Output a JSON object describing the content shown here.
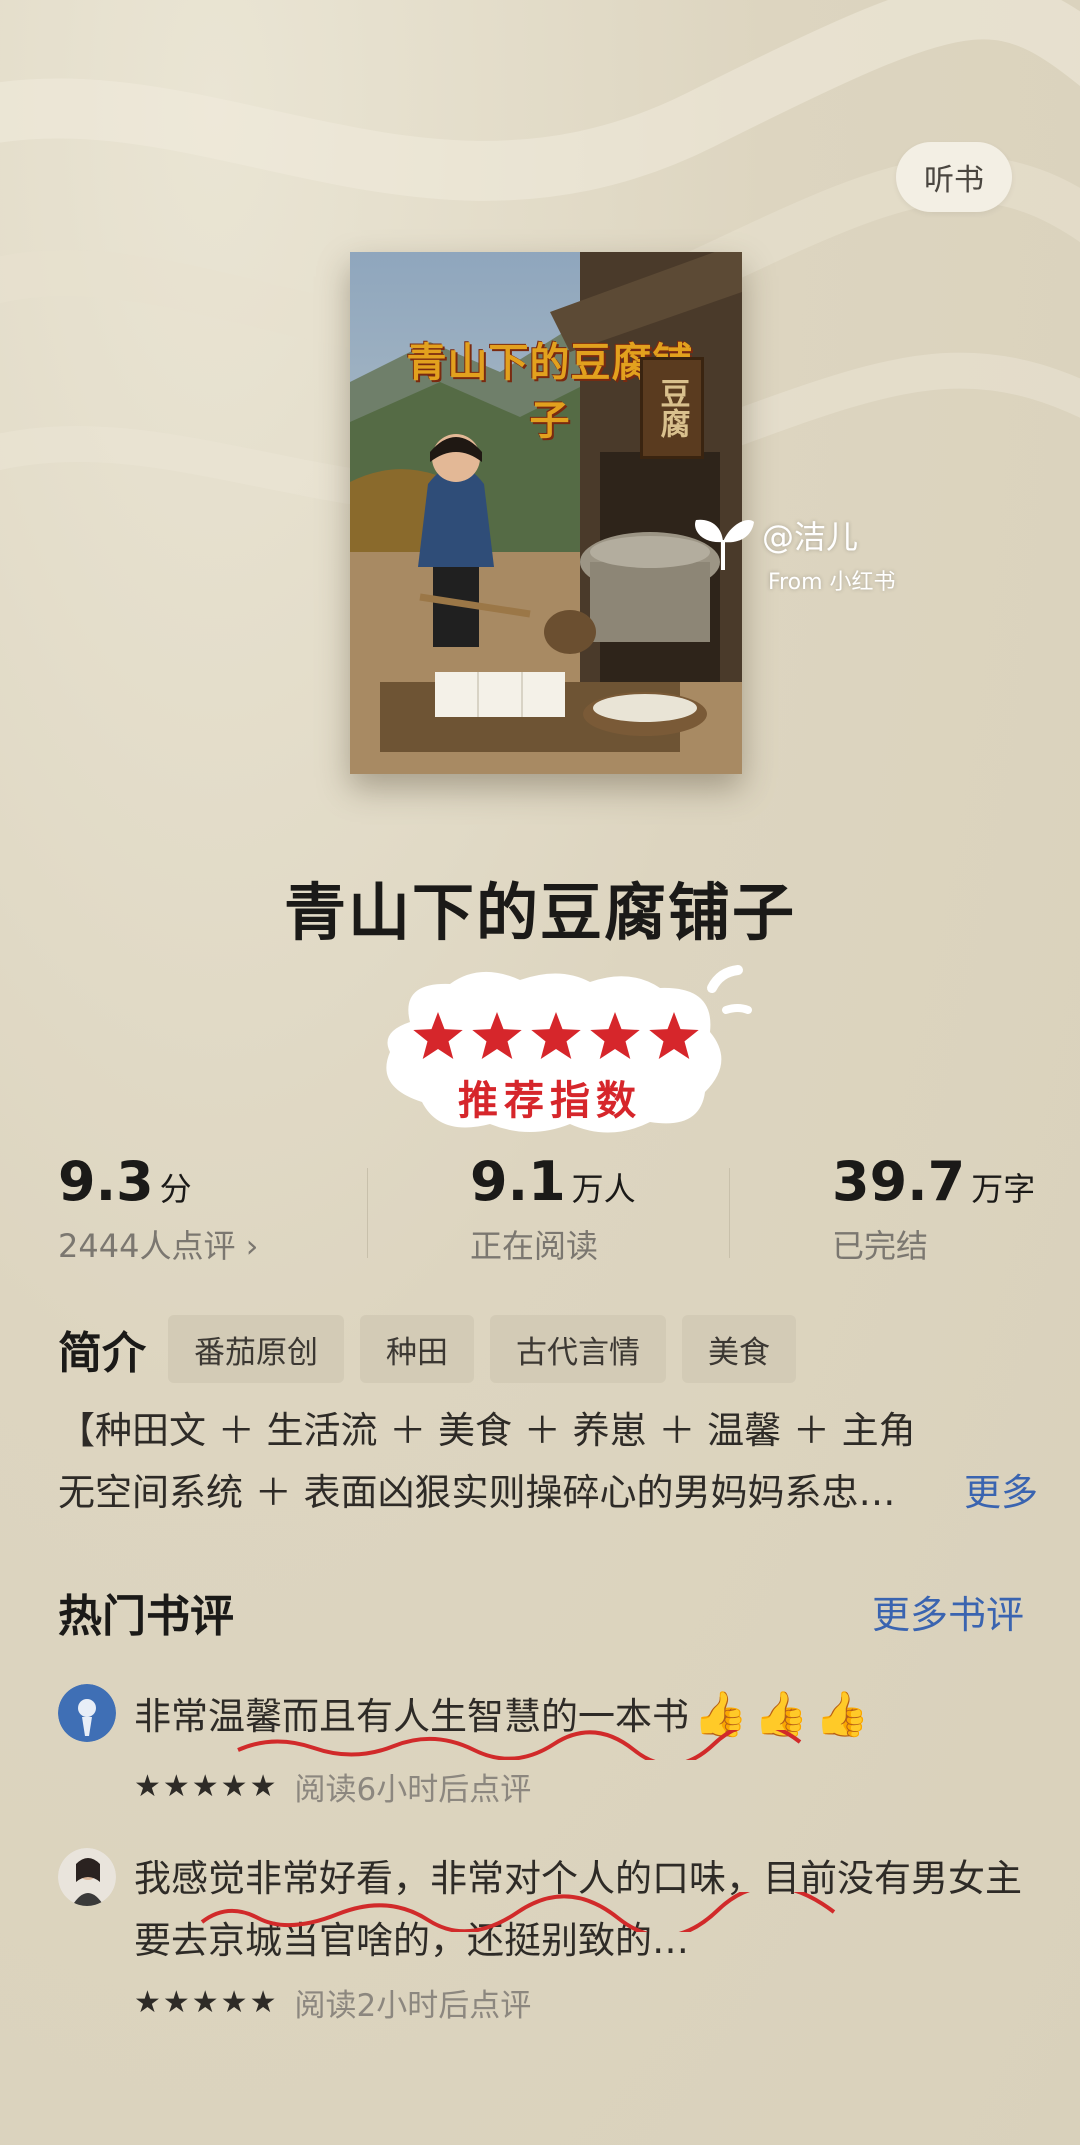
{
  "header": {
    "listen_label": "听书"
  },
  "cover": {
    "title": "青山下的豆腐铺子",
    "sign_text": "豆腐"
  },
  "watermark": {
    "user": "@洁儿",
    "from": "From 小红书"
  },
  "book": {
    "title": "青山下的豆腐铺子"
  },
  "badge": {
    "stars_count": 5,
    "text": "推荐指数",
    "color": "#d6262b"
  },
  "stats": {
    "score": {
      "value": "9.3",
      "unit": "分",
      "sub": "2444人点评 ›"
    },
    "readers": {
      "value": "9.1",
      "unit": "万人",
      "sub": "正在阅读"
    },
    "words": {
      "value": "39.7",
      "unit": "万字",
      "sub": "已完结"
    }
  },
  "intro": {
    "label": "简介",
    "tags": [
      "番茄原创",
      "种田",
      "古代言情",
      "美食"
    ],
    "synopsis": "【种田文 ＋ 生活流 ＋ 美食 ＋ 养崽 ＋ 温馨 ＋ 主角无空间系统 ＋ 表面凶狠实则操碎心的男妈妈系忠…",
    "more_label": "更多"
  },
  "reviews_section": {
    "title": "热门书评",
    "more_label": "更多书评"
  },
  "reviews": [
    {
      "text": "非常温馨而且有人生智慧的一本书",
      "thumbs": "👍👍👍",
      "stars": "★★★★★",
      "meta": "阅读6小时后点评"
    },
    {
      "text": "我感觉非常好看，非常对个人的口味，目前没有男女主要去京城当官啥的，还挺别致的…",
      "stars": "★★★★★",
      "meta": "阅读2小时后点评"
    }
  ],
  "colors": {
    "accent_blue": "#3a64b0",
    "badge_red": "#d6262b",
    "background": "#ddd5c0"
  }
}
